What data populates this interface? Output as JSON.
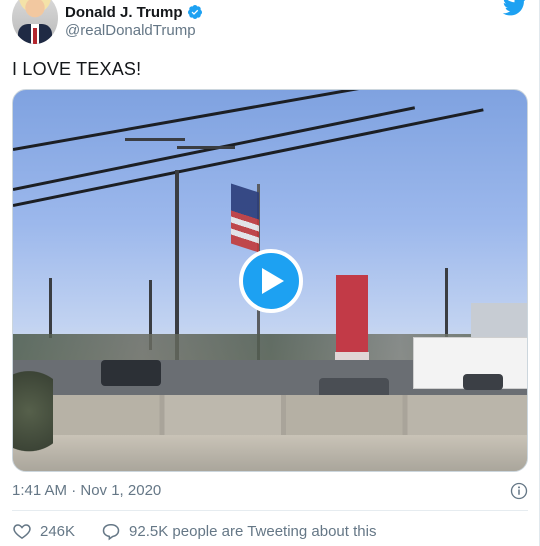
{
  "author": {
    "display_name": "Donald J. Trump",
    "handle": "@realDonaldTrump",
    "verified": true
  },
  "tweet": {
    "text": "I LOVE TEXAS!",
    "timestamp": "1:41 AM · Nov 1, 2020"
  },
  "media": {
    "type": "video",
    "play_icon": "play-icon"
  },
  "actions": {
    "like_count": "246K",
    "reply_text": "92.5K people are Tweeting about this"
  },
  "colors": {
    "brand": "#1da1f2",
    "text_primary": "#14171a",
    "text_secondary": "#657786"
  },
  "icons": {
    "logo": "twitter-bird-icon",
    "verified": "verified-badge-icon",
    "info": "info-icon",
    "like": "heart-icon",
    "reply": "speech-bubble-icon"
  }
}
